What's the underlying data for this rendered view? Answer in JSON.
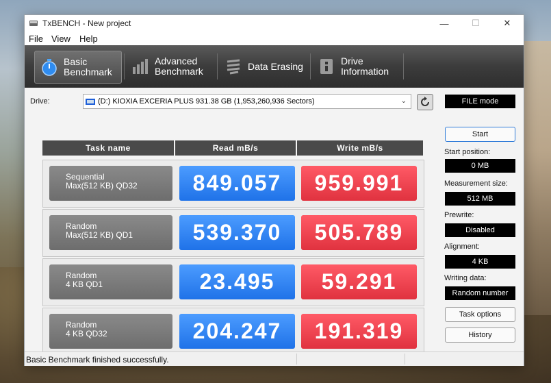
{
  "window": {
    "title": "TxBENCH - New project"
  },
  "menu": [
    "File",
    "View",
    "Help"
  ],
  "tabs": [
    {
      "line1": "Basic",
      "line2": "Benchmark",
      "icon": "stopwatch-icon"
    },
    {
      "line1": "Advanced",
      "line2": "Benchmark",
      "icon": "bar-chart-icon"
    },
    {
      "line1": "Data Erasing",
      "line2": "",
      "icon": "eraser-icon"
    },
    {
      "line1": "Drive",
      "line2": "Information",
      "icon": "drive-info-icon"
    }
  ],
  "drive": {
    "label": "Drive:",
    "selected": "(D:) KIOXIA EXCERIA PLUS  931.38 GB (1,953,260,936 Sectors)",
    "mode": "FILE mode"
  },
  "table": {
    "headers": [
      "Task name",
      "Read mB/s",
      "Write mB/s"
    ],
    "rows": [
      {
        "task1": "Sequential",
        "task2": "Max(512 KB) QD32",
        "read": "849.057",
        "write": "959.991"
      },
      {
        "task1": "Random",
        "task2": "Max(512 KB) QD1",
        "read": "539.370",
        "write": "505.789"
      },
      {
        "task1": "Random",
        "task2": "4 KB QD1",
        "read": "23.495",
        "write": "59.291"
      },
      {
        "task1": "Random",
        "task2": "4 KB QD32",
        "read": "204.247",
        "write": "191.319"
      }
    ]
  },
  "side": {
    "start": "Start",
    "start_position_label": "Start position:",
    "start_position": "0 MB",
    "measurement_size_label": "Measurement size:",
    "measurement_size": "512 MB",
    "prewrite_label": "Prewrite:",
    "prewrite": "Disabled",
    "alignment_label": "Alignment:",
    "alignment": "4 KB",
    "writing_data_label": "Writing data:",
    "writing_data": "Random number",
    "task_options": "Task options",
    "history": "History"
  },
  "status": {
    "text": "Basic Benchmark finished successfully."
  },
  "colors": {
    "read": "#2f84f5",
    "write": "#ec4451",
    "toolbar": "#3c3c3c"
  }
}
